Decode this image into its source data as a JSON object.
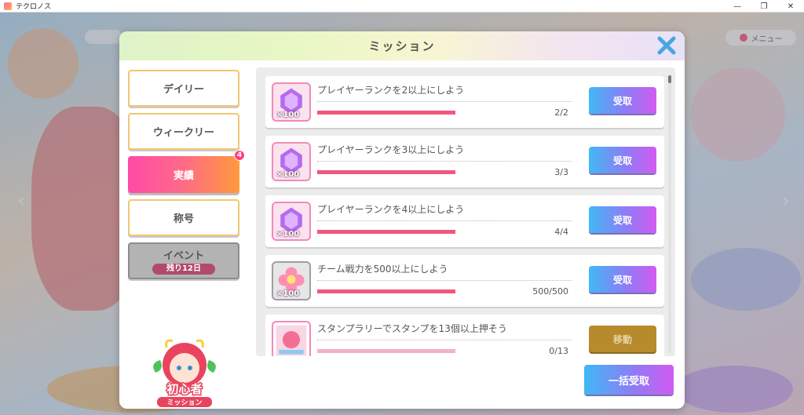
{
  "window": {
    "title": "テクロノス",
    "controls": [
      "—",
      "❐",
      "✕"
    ]
  },
  "background": {
    "menu_label": "メニュー"
  },
  "dialog": {
    "title": "ミッション",
    "close_icon": "close-x-icon"
  },
  "tabs": [
    {
      "label": "デイリー",
      "active": false
    },
    {
      "label": "ウィークリー",
      "active": false
    },
    {
      "label": "実績",
      "active": true,
      "badge": "4"
    },
    {
      "label": "称号",
      "active": false
    },
    {
      "label": "イベント",
      "sub_label": "残り12日",
      "disabled": true
    }
  ],
  "beginner": {
    "line1": "初心者",
    "line2": "ミッション"
  },
  "missions": [
    {
      "title": "プレイヤーランクを2以上にしよう",
      "reward": "gem-icon",
      "quantity": "×100",
      "progress_text": "2/2",
      "progress": 1.0,
      "button": "受取"
    },
    {
      "title": "プレイヤーランクを3以上にしよう",
      "reward": "gem-icon",
      "quantity": "×100",
      "progress_text": "3/3",
      "progress": 1.0,
      "button": "受取"
    },
    {
      "title": "プレイヤーランクを4以上にしよう",
      "reward": "gem-icon",
      "quantity": "×100",
      "progress_text": "4/4",
      "progress": 1.0,
      "button": "受取"
    },
    {
      "title": "チーム戦力を500以上にしよう",
      "reward": "flower-coin-icon",
      "quantity": "×100",
      "progress_text": "500/500",
      "progress": 1.0,
      "button": "受取"
    },
    {
      "title": "スタンプラリーでスタンプを13個以上押そう",
      "reward": "stamp-card-icon",
      "quantity": "",
      "progress_text": "0/13",
      "progress": 0.0,
      "button": "移動"
    }
  ],
  "bulk_button": "一括受取",
  "colors": {
    "accent_gradient_start": "#41b8f5",
    "accent_gradient_end": "#d15bf0",
    "active_tab_start": "#ff4aa8",
    "active_tab_end": "#ff9a3c",
    "progress_fill": "#f2577d",
    "move_button": "#b78a2c"
  }
}
